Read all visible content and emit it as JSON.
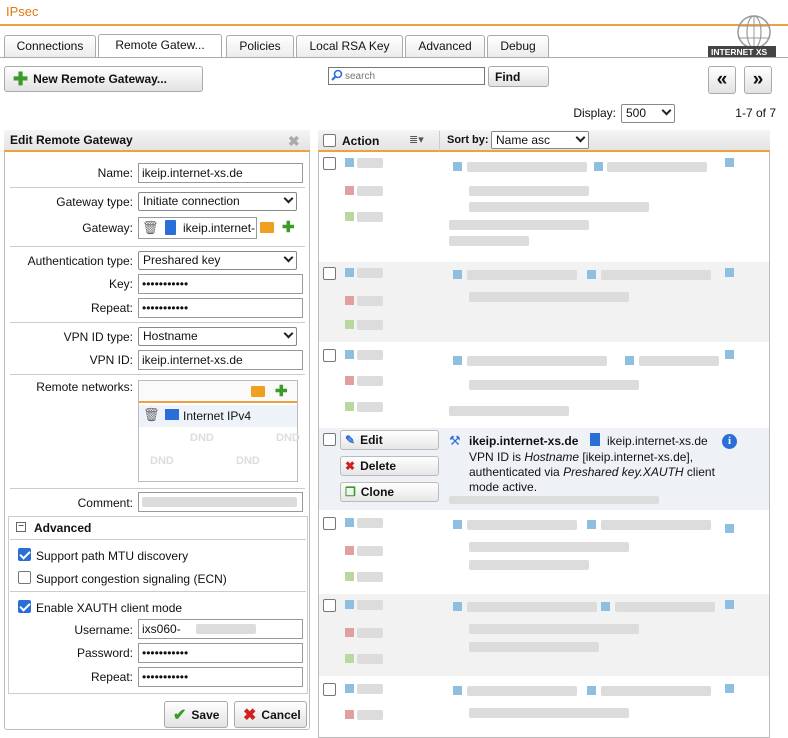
{
  "app": {
    "title": "IPsec",
    "logo_text": "INTERNET XS"
  },
  "tabs": [
    {
      "label": "Connections"
    },
    {
      "label": "Remote Gatew..."
    },
    {
      "label": "Policies"
    },
    {
      "label": "Local RSA Key"
    },
    {
      "label": "Advanced"
    },
    {
      "label": "Debug"
    }
  ],
  "toolbar": {
    "new_label": "New Remote Gateway...",
    "search_placeholder": "search",
    "find_label": "Find",
    "prev_label": "«",
    "next_label": "»",
    "display_label": "Display:",
    "display_value": "500",
    "range_label": "1-7 of 7"
  },
  "edit": {
    "title": "Edit Remote Gateway",
    "name_label": "Name:",
    "name_value": "ikeip.internet-xs.de",
    "gwtype_label": "Gateway type:",
    "gwtype_value": "Initiate connection",
    "gateway_label": "Gateway:",
    "gateway_value": "ikeip.internet-",
    "auth_label": "Authentication type:",
    "auth_value": "Preshared key",
    "key_label": "Key:",
    "key_value": "•••••••••••",
    "repeat_label": "Repeat:",
    "repeat_value": "•••••••••••",
    "vpnidtype_label": "VPN ID type:",
    "vpnidtype_value": "Hostname",
    "vpnid_label": "VPN ID:",
    "vpnid_value": "ikeip.internet-xs.de",
    "networks_label": "Remote networks:",
    "network_item": "Internet IPv4",
    "dnd": "DND",
    "comment_label": "Comment:",
    "advanced_label": "Advanced",
    "mtu_label": "Support path MTU discovery",
    "ecn_label": "Support congestion signaling (ECN)",
    "xauth_label": "Enable XAUTH client mode",
    "username_label": "Username:",
    "username_value": "ixs060-",
    "password_label": "Password:",
    "password_value": "•••••••••••",
    "repeat2_label": "Repeat:",
    "repeat2_value": "•••••••••••",
    "save_label": "Save",
    "cancel_label": "Cancel"
  },
  "list": {
    "action_label": "Action",
    "sortby_label": "Sort by:",
    "sort_value": "Name asc",
    "selected": {
      "edit_label": "Edit",
      "delete_label": "Delete",
      "clone_label": "Clone",
      "name": "ikeip.internet-xs.de",
      "host": "ikeip.internet-xs.de",
      "desc1_a": "VPN ID is ",
      "desc1_b": "Hostname",
      "desc1_c": " [ikeip.internet-xs.de],",
      "desc2_a": "authenticated via ",
      "desc2_b": "Preshared key.XAUTH",
      "desc2_c": " client",
      "desc3": "mode active."
    }
  },
  "colors": {
    "accent": "#f0a040",
    "title": "#e07a10",
    "check": "#2a6ed8"
  }
}
